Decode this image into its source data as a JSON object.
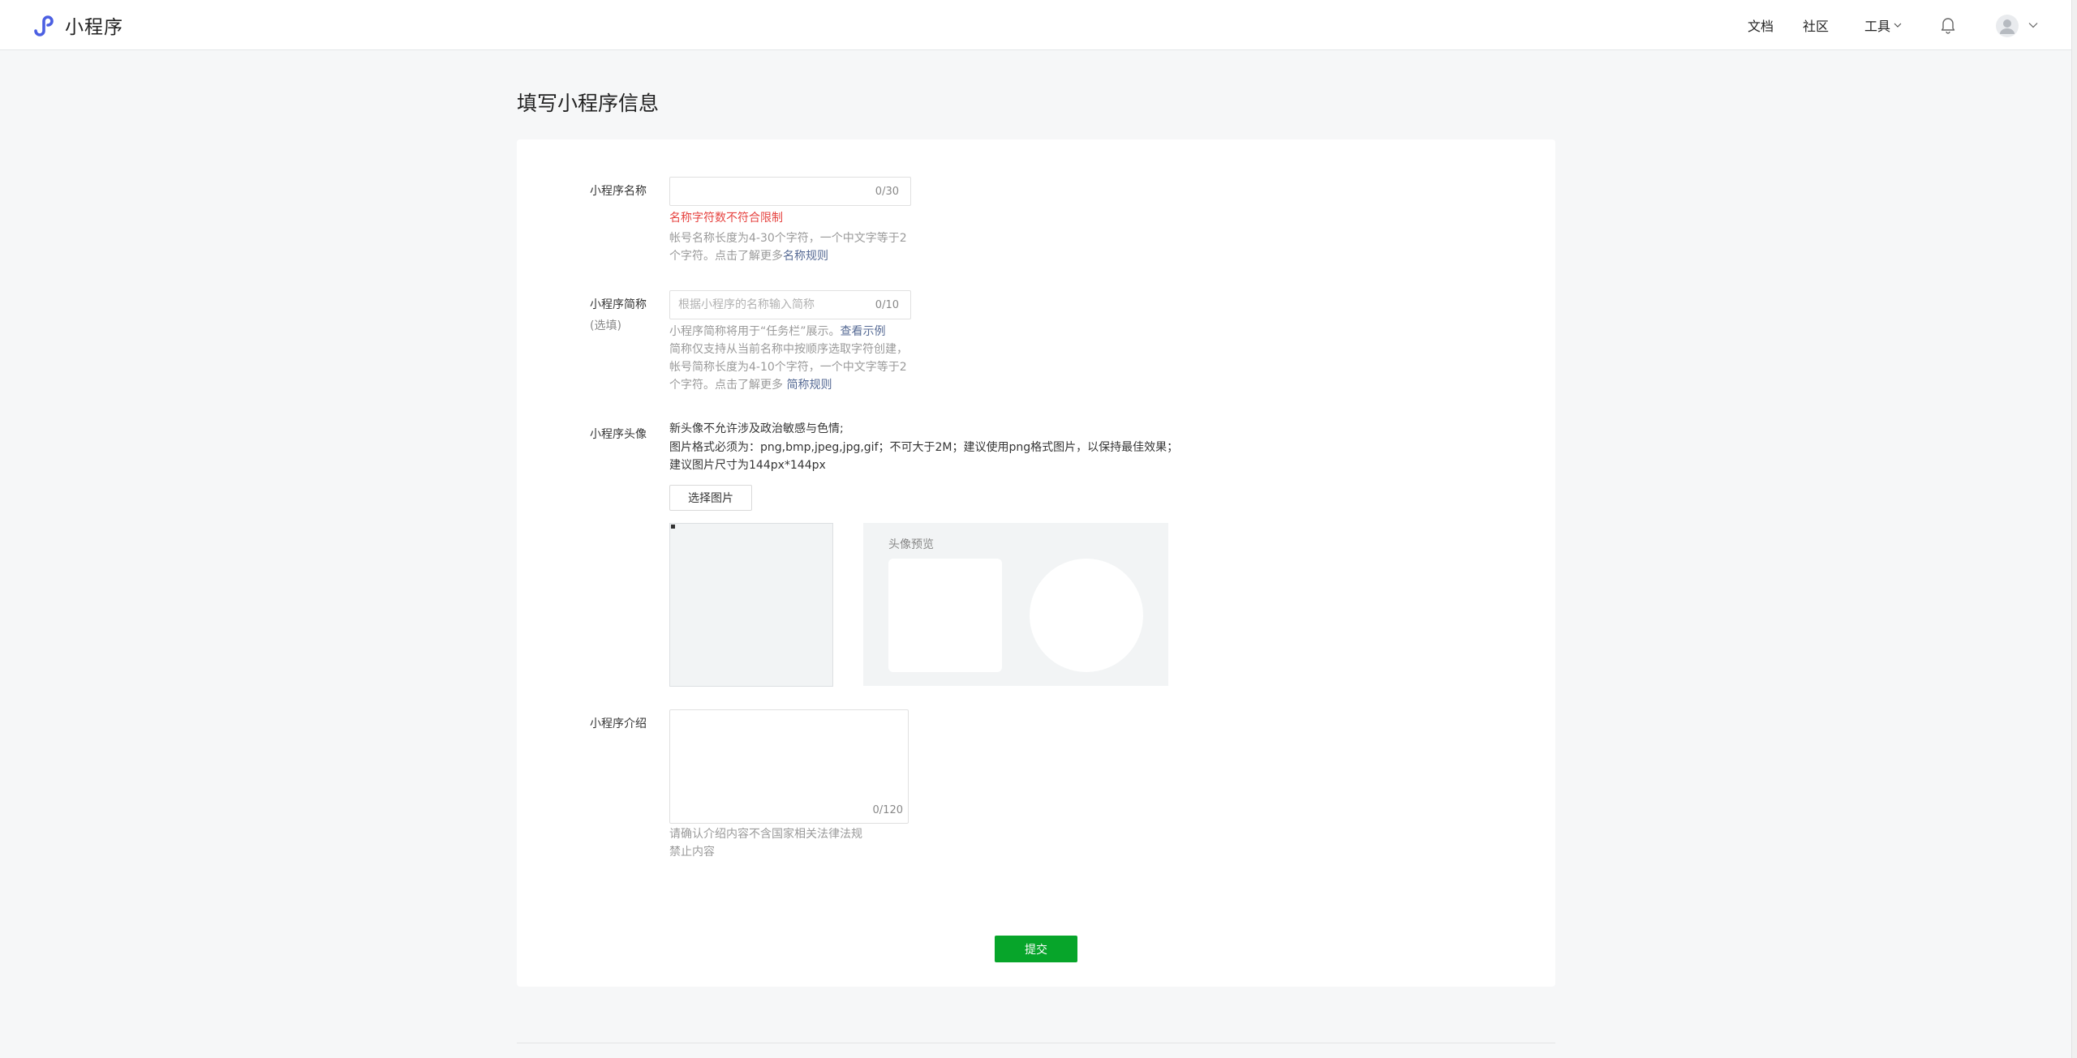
{
  "header": {
    "brand": "小程序",
    "nav": {
      "docs": "文档",
      "community": "社区",
      "tools": "工具"
    },
    "brand_color": "#4b5fe2"
  },
  "page": {
    "title": "填写小程序信息"
  },
  "form": {
    "name": {
      "label": "小程序名称",
      "value": "",
      "counter": "0/30",
      "error": "名称字符数不符合限制",
      "tip_line1": "帐号名称长度为4-30个字符，一个中文字等于2",
      "tip_line2": "个字符。点击了解更多",
      "tip_link": "名称规则"
    },
    "short_name": {
      "label": "小程序简称",
      "optional": "(选填)",
      "placeholder": "根据小程序的名称输入简称",
      "counter": "0/10",
      "tip_line1": "小程序简称将用于“任务栏”展示。",
      "tip_line1_link": "查看示例",
      "tip_line2": "简称仅支持从当前名称中按顺序选取字符创建，",
      "tip_line3": "帐号简称长度为4-10个字符，一个中文字等于2",
      "tip_line4": "个字符。点击了解更多",
      "tip_link": "简称规则"
    },
    "avatar": {
      "label": "小程序头像",
      "note1": "新头像不允许涉及政治敏感与色情;",
      "note2": "图片格式必须为：png,bmp,jpeg,jpg,gif；不可大于2M；建议使用png格式图片，以保持最佳效果；",
      "note3": "建议图片尺寸为144px*144px",
      "choose_button": "选择图片",
      "preview_title": "头像预览"
    },
    "intro": {
      "label": "小程序介绍",
      "value": "",
      "counter": "0/120",
      "tip_line1": "请确认介绍内容不含国家相关法律法规",
      "tip_line2": "禁止内容"
    },
    "submit": "提交",
    "submit_color": "#07a52a",
    "error_color": "#e64340",
    "link_color": "#576b95"
  }
}
